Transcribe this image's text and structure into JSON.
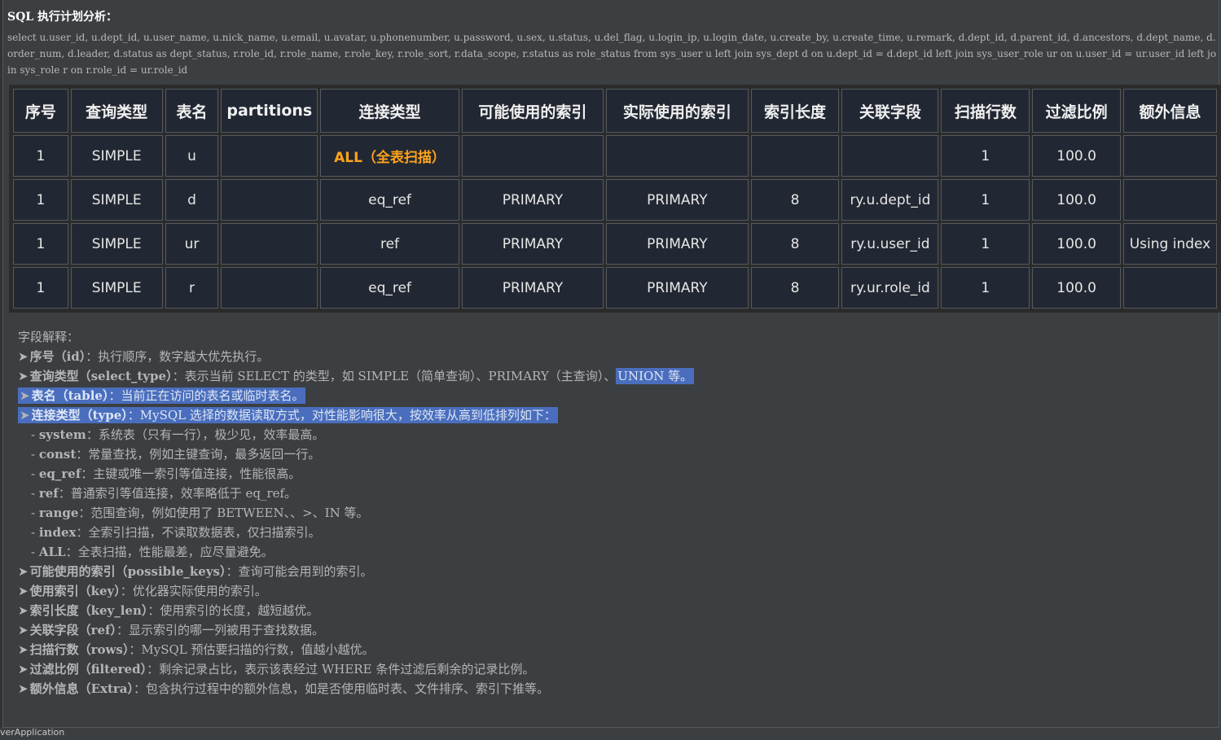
{
  "title": "SQL 执行计划分析：",
  "sql": "select u.user_id, u.dept_id, u.user_name, u.nick_name, u.email, u.avatar, u.phonenumber, u.password, u.sex, u.status, u.del_flag, u.login_ip, u.login_date, u.create_by, u.create_time, u.remark, d.dept_id, d.parent_id, d.ancestors, d.dept_name, d.order_num, d.leader, d.status as dept_status, r.role_id, r.role_name, r.role_key, r.role_sort, r.data_scope, r.status as role_status from sys_user u left join sys_dept d on u.dept_id = d.dept_id left join sys_user_role ur on u.user_id = ur.user_id left join sys_role r on r.role_id = ur.role_id",
  "table": {
    "headers": [
      "序号",
      "查询类型",
      "表名",
      "partitions",
      "连接类型",
      "可能使用的索引",
      "实际使用的索引",
      "索引长度",
      "关联字段",
      "扫描行数",
      "过滤比例",
      "额外信息"
    ],
    "rows": [
      [
        "1",
        "SIMPLE",
        "u",
        "",
        "ALL（全表扫描）",
        "",
        "",
        "",
        "",
        "1",
        "100.0",
        ""
      ],
      [
        "1",
        "SIMPLE",
        "d",
        "",
        "eq_ref",
        "PRIMARY",
        "PRIMARY",
        "8",
        "ry.u.dept_id",
        "1",
        "100.0",
        ""
      ],
      [
        "1",
        "SIMPLE",
        "ur",
        "",
        "ref",
        "PRIMARY",
        "PRIMARY",
        "8",
        "ry.u.user_id",
        "1",
        "100.0",
        "Using index"
      ],
      [
        "1",
        "SIMPLE",
        "r",
        "",
        "eq_ref",
        "PRIMARY",
        "PRIMARY",
        "8",
        "ry.ur.role_id",
        "1",
        "100.0",
        ""
      ]
    ],
    "warning_color": "#ffa31a"
  },
  "explain": {
    "heading": "字段解释：",
    "arrow": "➤",
    "dash": "-",
    "items": [
      {
        "name": "序号（id）",
        "desc": "：执行顺序，数字越大优先执行。"
      },
      {
        "name": "查询类型（select_type）",
        "desc_a": "：表示当前 SELECT 的类型，如 SIMPLE（简单查询）、PRIMARY（主查询）、",
        "desc_b": "UNION 等。"
      },
      {
        "name": "表名（table）",
        "desc": "：当前正在访问的表名或临时表名。"
      },
      {
        "name": "连接类型（type）",
        "desc": "：MySQL 选择的数据读取方式，对性能影响很大，按效率从高到低排列如下："
      },
      {
        "name": "可能使用的索引（possible_keys）",
        "desc": "：查询可能会用到的索引。"
      },
      {
        "name": "使用索引（key）",
        "desc": "：优化器实际使用的索引。"
      },
      {
        "name": "索引长度（key_len）",
        "desc": "：使用索引的长度，越短越优。"
      },
      {
        "name": "关联字段（ref）",
        "desc": "：显示索引的哪一列被用于查找数据。"
      },
      {
        "name": "扫描行数（rows）",
        "desc": "：MySQL 预估要扫描的行数，值越小越优。"
      },
      {
        "name": "过滤比例（filtered）",
        "desc": "：剩余记录占比，表示该表经过 WHERE 条件过滤后剩余的记录比例。"
      },
      {
        "name": "额外信息（Extra）",
        "desc": "：包含执行过程中的额外信息，如是否使用临时表、文件排序、索引下推等。"
      }
    ],
    "types": [
      {
        "term": "system",
        "desc": "：系统表（只有一行），极少见，效率最高。"
      },
      {
        "term": "const",
        "desc": "：常量查找，例如主键查询，最多返回一行。"
      },
      {
        "term": "eq_ref",
        "desc": "：主键或唯一索引等值连接，性能很高。"
      },
      {
        "term": "ref",
        "desc": "：普通索引等值连接，效率略低于 eq_ref。"
      },
      {
        "term": "range",
        "desc": "：范围查询，例如使用了 BETWEEN、、>、IN 等。"
      },
      {
        "term": "index",
        "desc": "：全索引扫描，不读取数据表，仅扫描索引。"
      },
      {
        "term": "ALL",
        "desc": "：全表扫描，性能最差，应尽量避免。"
      }
    ],
    "highlight_color": "#4a6ebd"
  },
  "status_text": "verApplication"
}
